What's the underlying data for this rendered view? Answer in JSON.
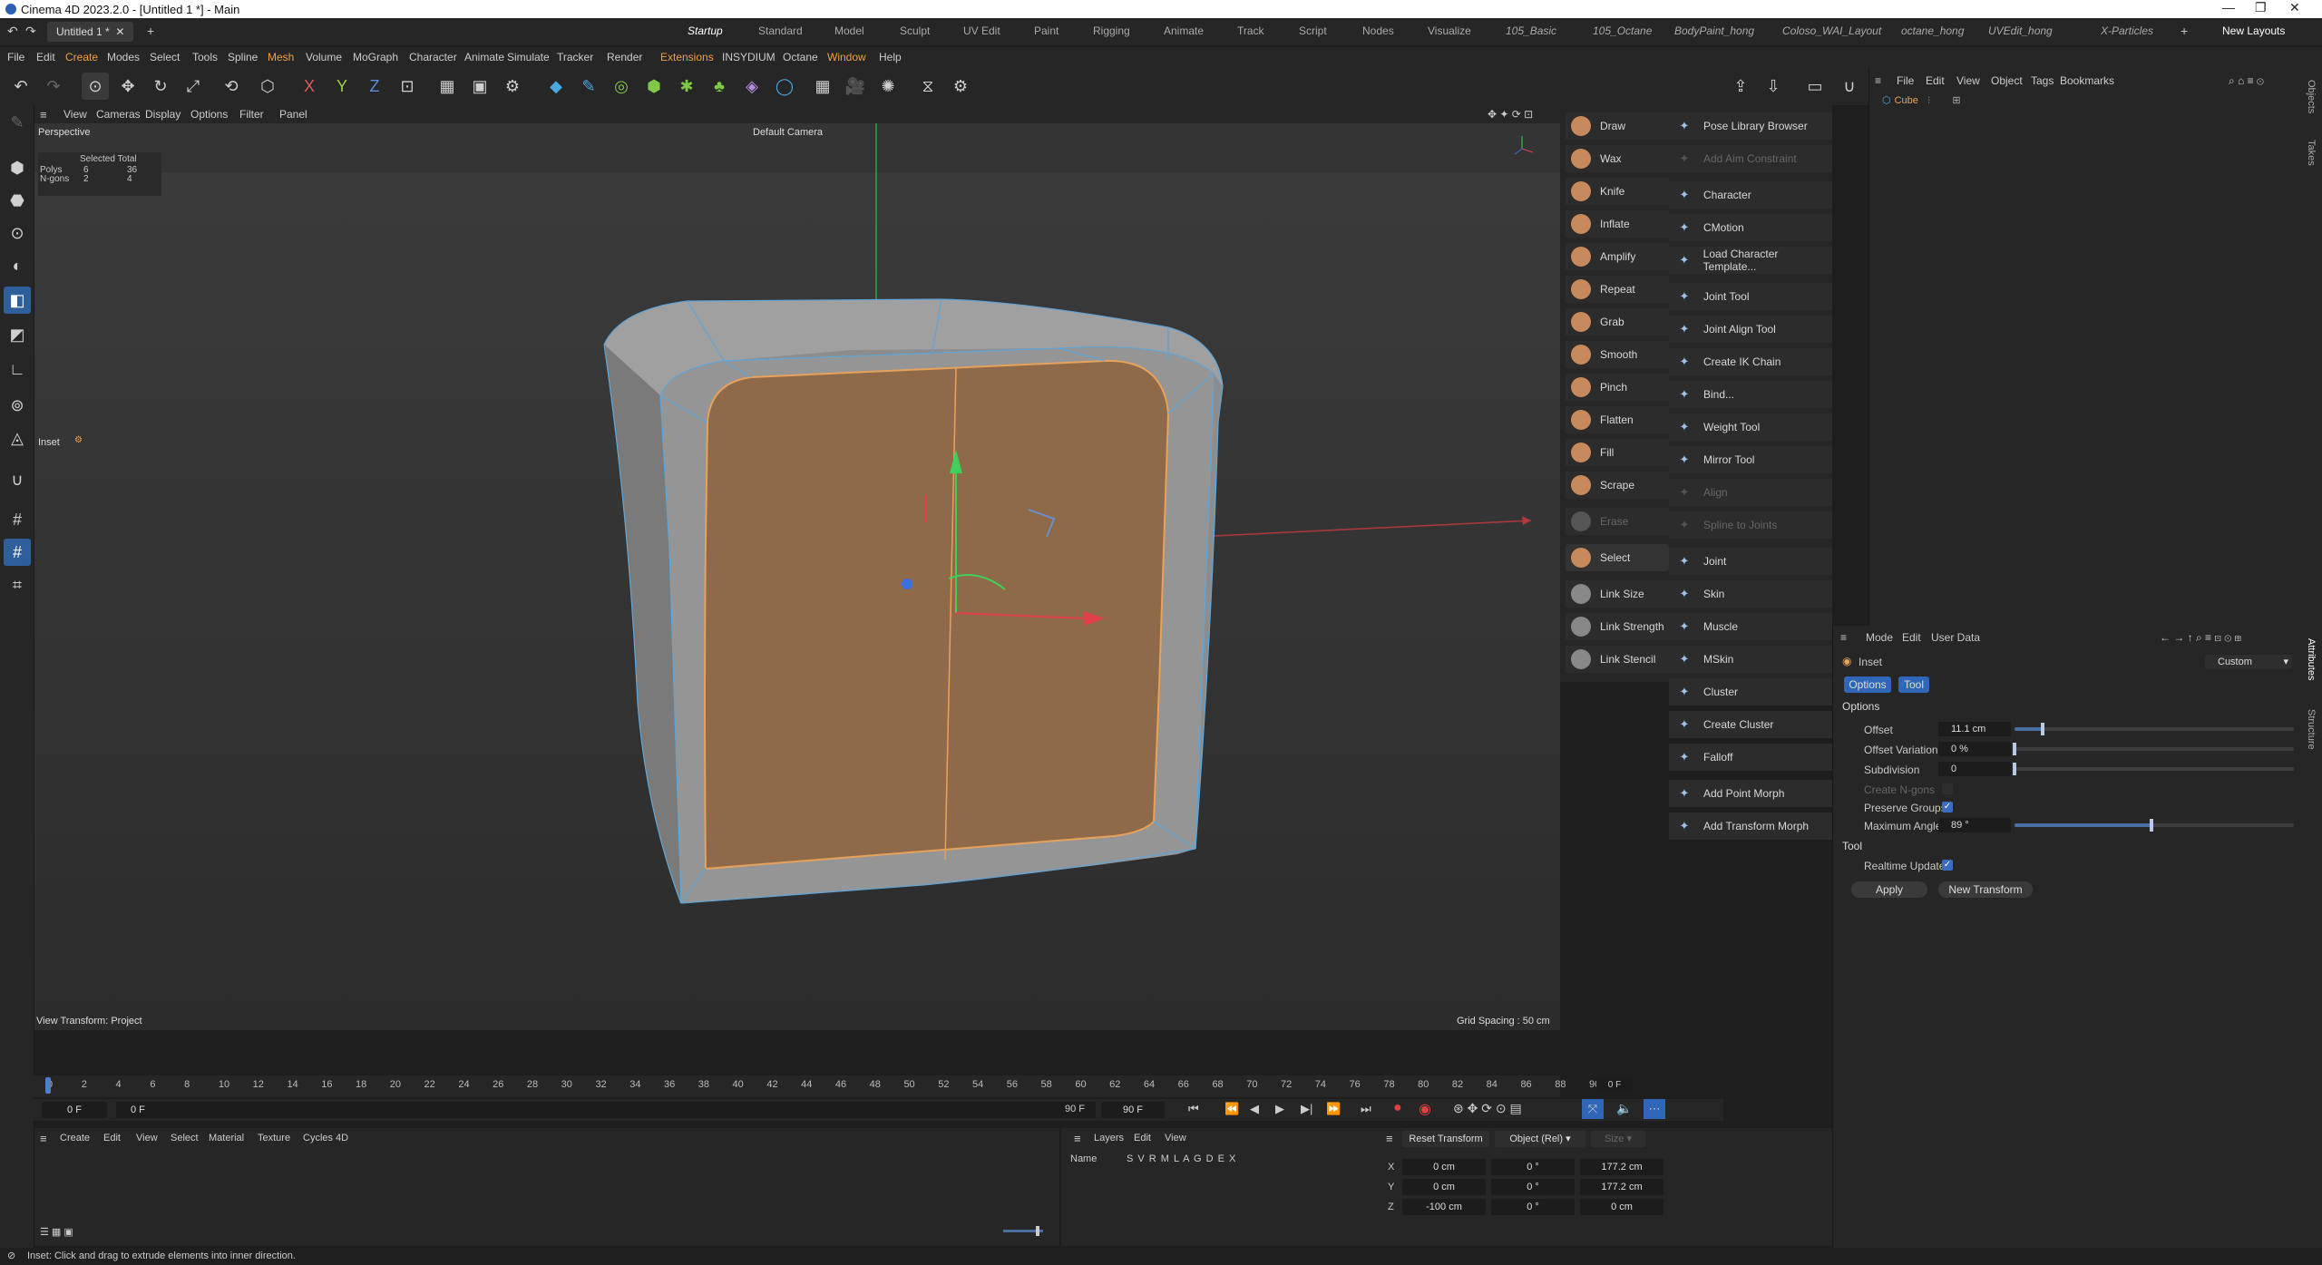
{
  "window": {
    "title": "Cinema 4D 2023.2.0 - [Untitled 1 *] - Main"
  },
  "doc_tab": "Untitled 1 *",
  "layout_tabs": [
    "Startup",
    "Standard",
    "Model",
    "Sculpt",
    "UV Edit",
    "Paint",
    "Rigging",
    "Animate",
    "Track",
    "Script",
    "Nodes",
    "Visualize",
    "105_Basic",
    "105_Octane",
    "BodyPaint_hong",
    "Coloso_WAI_Layout",
    "octane_hong",
    "UVEdit_hong",
    "X-Particles"
  ],
  "new_layouts": "New Layouts",
  "menu": [
    "File",
    "Edit",
    "Create",
    "Modes",
    "Select",
    "Tools",
    "Spline",
    "Mesh",
    "Volume",
    "MoGraph",
    "Character",
    "Animate",
    "Simulate",
    "Tracker",
    "Render",
    "Extensions",
    "INSYDIUM",
    "Octane",
    "Window",
    "Help"
  ],
  "viewport": {
    "menu": [
      "View",
      "Cameras",
      "Display",
      "Options",
      "Filter",
      "Panel"
    ],
    "name": "Perspective",
    "camera": "Default Camera",
    "stats": {
      "header": "Selected Total",
      "rows": [
        {
          "label": "Polys",
          "sel": "6",
          "total": "36"
        },
        {
          "label": "N-gons",
          "sel": "2",
          "total": "4"
        }
      ]
    },
    "tool_label": "Inset",
    "view_transform": "View Transform: Project",
    "grid_spacing": "Grid Spacing : 50 cm"
  },
  "palette_left": [
    {
      "label": "Draw",
      "color": "#c78a5c"
    },
    {
      "label": "Wax",
      "color": "#c78a5c"
    },
    {
      "label": "Knife",
      "color": "#c78a5c"
    },
    {
      "label": "Inflate",
      "color": "#c78a5c"
    },
    {
      "label": "Amplify",
      "color": "#c78a5c"
    },
    {
      "label": "Repeat",
      "color": "#c78a5c"
    },
    {
      "label": "Grab",
      "color": "#c78a5c"
    },
    {
      "label": "Smooth",
      "color": "#c78a5c"
    },
    {
      "label": "Pinch",
      "color": "#c78a5c"
    },
    {
      "label": "Flatten",
      "color": "#c78a5c"
    },
    {
      "label": "Fill",
      "color": "#c78a5c"
    },
    {
      "label": "Scrape",
      "color": "#c78a5c"
    },
    {
      "label": "Erase",
      "color": "#555",
      "dim": true
    },
    {
      "label": "Select",
      "color": "#c78a5c"
    },
    {
      "label": "Link Size",
      "color": "#888"
    },
    {
      "label": "Link Strength",
      "color": "#888"
    },
    {
      "label": "Link Stencil",
      "color": "#888"
    }
  ],
  "palette_right": [
    {
      "label": "Pose Library Browser"
    },
    {
      "label": "Add Aim Constraint",
      "dim": true
    },
    {
      "label": "Character"
    },
    {
      "label": "CMotion"
    },
    {
      "label": "Load Character Template..."
    },
    {
      "label": "Joint Tool"
    },
    {
      "label": "Joint Align Tool"
    },
    {
      "label": "Create IK Chain"
    },
    {
      "label": "Bind..."
    },
    {
      "label": "Weight Tool"
    },
    {
      "label": "Mirror Tool"
    },
    {
      "label": "Align",
      "dim": true
    },
    {
      "label": "Spline to Joints",
      "dim": true
    },
    {
      "label": "Joint"
    },
    {
      "label": "Skin"
    },
    {
      "label": "Muscle"
    },
    {
      "label": "MSkin"
    },
    {
      "label": "Cluster"
    },
    {
      "label": "Create Cluster"
    },
    {
      "label": "Falloff"
    },
    {
      "label": "Add Point Morph"
    },
    {
      "label": "Add Transform Morph"
    }
  ],
  "objects": {
    "menu": [
      "File",
      "Edit",
      "View",
      "Object",
      "Tags",
      "Bookmarks"
    ],
    "item": "Cube"
  },
  "attributes": {
    "menu": [
      "Mode",
      "Edit",
      "User Data"
    ],
    "tool_name": "Inset",
    "preset": "Custom",
    "tabs": [
      "Options",
      "Tool"
    ],
    "section_options": "Options",
    "offset": {
      "label": "Offset",
      "value": "11.1 cm",
      "fraction": 0.1
    },
    "offset_variation": {
      "label": "Offset Variation",
      "value": "0 %",
      "fraction": 0.0
    },
    "subdivision": {
      "label": "Subdivision",
      "value": "0",
      "fraction": 0.0
    },
    "create_ngons": {
      "label": "Create N-gons",
      "checked": false
    },
    "preserve_groups": {
      "label": "Preserve Groups",
      "checked": true
    },
    "max_angle": {
      "label": "Maximum Angle",
      "value": "89 °",
      "fraction": 0.49
    },
    "section_tool": "Tool",
    "realtime_update": {
      "label": "Realtime Update",
      "checked": true
    },
    "apply": "Apply",
    "new_transform": "New Transform"
  },
  "side_tabs": [
    "Objects",
    "Takes",
    "Attributes",
    "Structure"
  ],
  "timeline": {
    "ticks": [
      "0",
      "2",
      "4",
      "6",
      "8",
      "10",
      "12",
      "14",
      "16",
      "18",
      "20",
      "22",
      "24",
      "26",
      "28",
      "30",
      "32",
      "34",
      "36",
      "38",
      "40",
      "42",
      "44",
      "46",
      "48",
      "50",
      "52",
      "54",
      "56",
      "58",
      "60",
      "62",
      "64",
      "66",
      "68",
      "70",
      "72",
      "74",
      "76",
      "78",
      "80",
      "82",
      "84",
      "86",
      "88",
      "90"
    ],
    "current_frame": "0 F",
    "start": "0 F",
    "min": "0 F",
    "end": "90 F",
    "max": "90 F"
  },
  "material_menu": [
    "Create",
    "Edit",
    "View",
    "Select",
    "Material",
    "Texture",
    "Cycles 4D"
  ],
  "layers": {
    "menu": [
      "Layers",
      "Edit",
      "View"
    ],
    "name_col": "Name",
    "flags": "S V R M L A G D E X"
  },
  "coords": {
    "reset": "Reset Transform",
    "mode": "Object (Rel)",
    "size": "Size",
    "rows": [
      {
        "axis": "X",
        "pos": "0 cm",
        "rot": "0 °",
        "size": "177.2 cm"
      },
      {
        "axis": "Y",
        "pos": "0 cm",
        "rot": "0 °",
        "size": "177.2 cm"
      },
      {
        "axis": "Z",
        "pos": "-100 cm",
        "rot": "0 °",
        "size": "0 cm"
      }
    ]
  },
  "status": "Inset: Click and drag to extrude elements into inner direction."
}
